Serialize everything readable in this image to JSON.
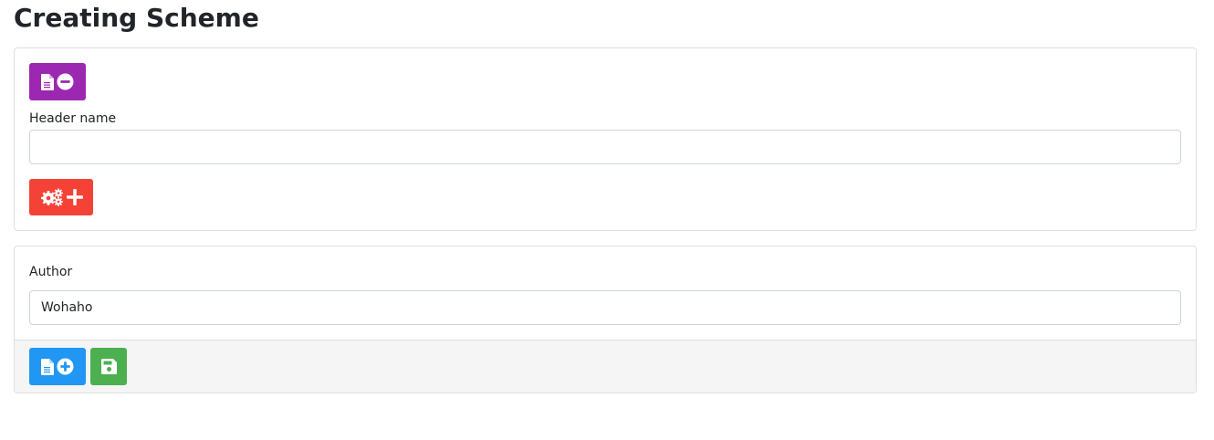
{
  "page": {
    "title": "Creating Scheme"
  },
  "header_section": {
    "remove_header_button_icon": "file-minus-icon",
    "header_name_label": "Header name",
    "header_name_value": "",
    "header_name_placeholder": "",
    "add_setting_button_icon": "gears-plus-icon"
  },
  "author_section": {
    "author_label": "Author",
    "author_value": "Wohaho",
    "add_header_button_icon": "file-plus-icon",
    "save_button_icon": "save-icon"
  },
  "colors": {
    "purple_button": "#9c27b0",
    "red_button": "#f44336",
    "blue_button": "#2196f3",
    "green_button": "#4caf50"
  }
}
